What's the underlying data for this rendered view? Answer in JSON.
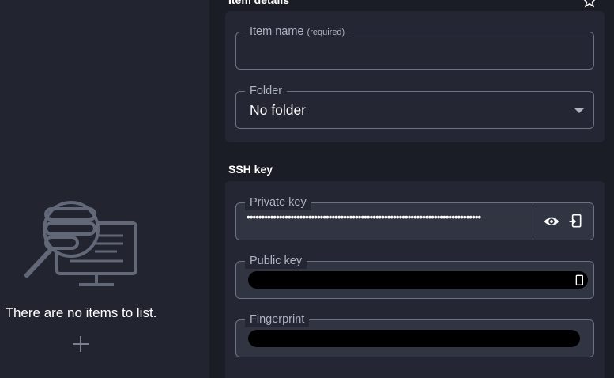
{
  "sidebar": {
    "empty_message": "There are no items to list.",
    "add_icon": "plus-icon",
    "illustration_icon": "search-monitor-icon"
  },
  "item_details": {
    "heading": "Item details",
    "favorite_icon": "star-icon",
    "name_field": {
      "label": "Item name",
      "hint": "(required)",
      "value": ""
    },
    "folder_field": {
      "label": "Folder",
      "value": "No folder"
    }
  },
  "ssh_key": {
    "heading": "SSH key",
    "private_key": {
      "label": "Private key",
      "value": "••••••••••••••••••••••••••••••••••••••••••••••••••••••••••••••••••••••••••••••••",
      "actions": [
        "eye-icon",
        "copy-icon"
      ]
    },
    "public_key": {
      "label": "Public key",
      "value_redacted": true,
      "action": "copy-icon"
    },
    "fingerprint": {
      "label": "Fingerprint",
      "value_redacted": true
    }
  },
  "colors": {
    "background": "#1b1d26",
    "sidebar": "#22252f",
    "card": "#242733",
    "field_border": "#6d7282",
    "label": "#aeb3c1"
  }
}
